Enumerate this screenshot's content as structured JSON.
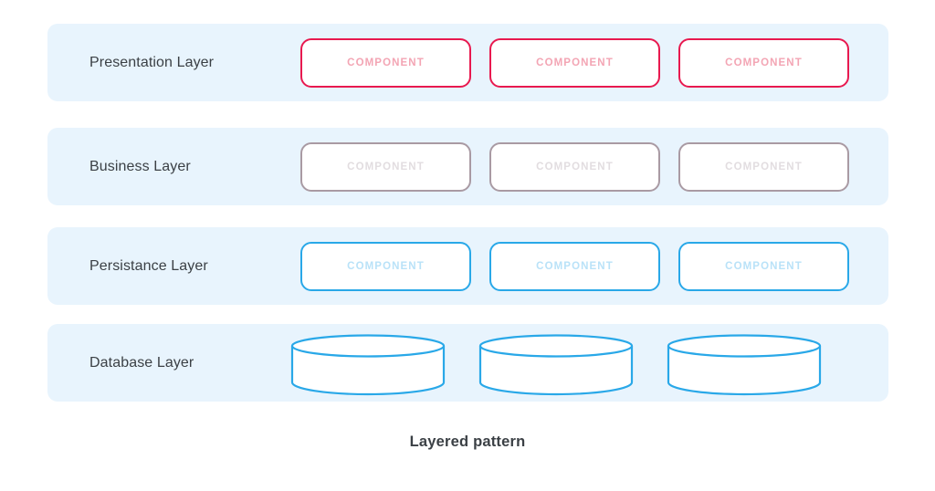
{
  "diagram": {
    "caption": "Layered pattern",
    "colors": {
      "band_background": "#e8f4fd",
      "label_text": "#3b4045",
      "presentation_border": "#e8194f",
      "presentation_text": "#f3a5b4",
      "business_border": "#a99aa3",
      "business_text": "#e2dde0",
      "persistance_border": "#29a8e8",
      "persistance_text": "#b9e2f8",
      "database_stroke": "#29a8e8",
      "database_fill": "#ffffff",
      "page_background": "#ffffff"
    },
    "layers": [
      {
        "id": "presentation",
        "label": "Presentation Layer",
        "node_type": "component-box",
        "nodes": [
          {
            "label": "COMPONENT"
          },
          {
            "label": "COMPONENT"
          },
          {
            "label": "COMPONENT"
          }
        ]
      },
      {
        "id": "business",
        "label": "Business Layer",
        "node_type": "component-box",
        "nodes": [
          {
            "label": "COMPONENT"
          },
          {
            "label": "COMPONENT"
          },
          {
            "label": "COMPONENT"
          }
        ]
      },
      {
        "id": "persistance",
        "label": "Persistance Layer",
        "node_type": "component-box",
        "nodes": [
          {
            "label": "COMPONENT"
          },
          {
            "label": "COMPONENT"
          },
          {
            "label": "COMPONENT"
          }
        ]
      },
      {
        "id": "database",
        "label": "Database Layer",
        "node_type": "cylinder",
        "nodes": [
          {
            "label": ""
          },
          {
            "label": ""
          },
          {
            "label": ""
          }
        ]
      }
    ]
  }
}
